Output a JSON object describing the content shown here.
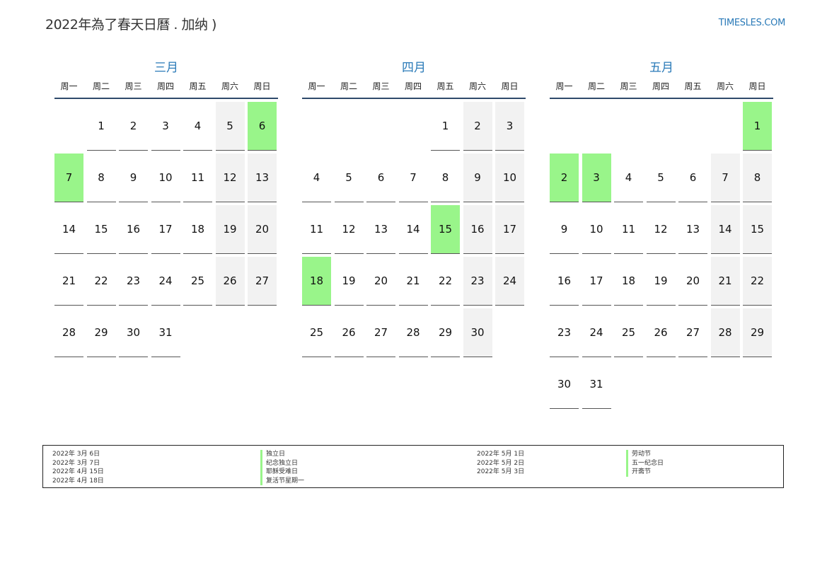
{
  "header": {
    "title": "2022年為了春天日曆 . 加纳 )",
    "site": "TIMESLES.COM"
  },
  "weekdays": [
    "周一",
    "周二",
    "周三",
    "周四",
    "周五",
    "周六",
    "周日"
  ],
  "colors": {
    "accent": "#2a7ab8",
    "holiday": "#99f58a",
    "weekend": "#f2f2f2"
  },
  "months": [
    {
      "name": "三月",
      "offset": 1,
      "days": 31,
      "holidays": [
        6,
        7
      ]
    },
    {
      "name": "四月",
      "offset": 4,
      "days": 30,
      "holidays": [
        15,
        18
      ]
    },
    {
      "name": "五月",
      "offset": 6,
      "days": 31,
      "holidays": [
        1,
        2,
        3
      ]
    }
  ],
  "legend": {
    "left_dates": [
      "2022年 3月 6日",
      "2022年 3月 7日",
      "2022年 4月 15日",
      "2022年 4月 18日"
    ],
    "left_names": [
      "独立日",
      "纪念独立日",
      "耶稣受难日",
      "复活节星期一"
    ],
    "right_dates": [
      "2022年 5月 1日",
      "2022年 5月 2日",
      "2022年 5月 3日"
    ],
    "right_names": [
      "劳动节",
      "五一纪念日",
      "开斋节"
    ]
  }
}
